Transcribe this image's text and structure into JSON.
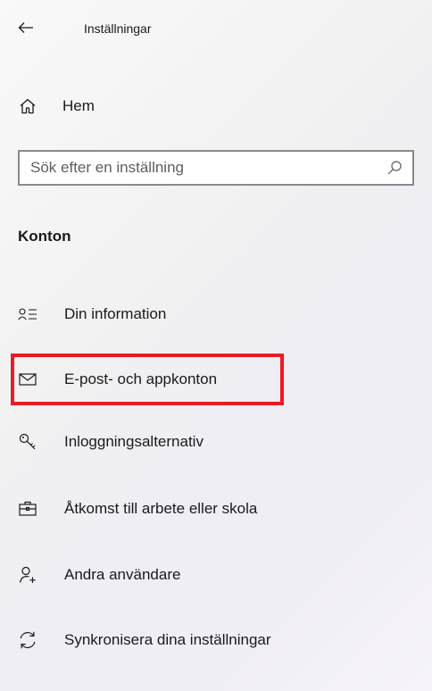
{
  "header": {
    "back_icon": "arrow-left-icon",
    "title": "Inställningar"
  },
  "home": {
    "icon": "home-icon",
    "label": "Hem"
  },
  "search": {
    "placeholder": "Sök efter en inställning",
    "value": "",
    "icon": "search-icon"
  },
  "section": {
    "heading": "Konton"
  },
  "nav": {
    "items": [
      {
        "icon": "person-list-icon",
        "label": "Din information"
      },
      {
        "icon": "mail-icon",
        "label": "E-post- och appkonton",
        "highlighted": true
      },
      {
        "icon": "key-icon",
        "label": "Inloggningsalternativ"
      },
      {
        "icon": "briefcase-icon",
        "label": "Åtkomst till arbete eller skola"
      },
      {
        "icon": "add-person-icon",
        "label": "Andra användare"
      },
      {
        "icon": "sync-icon",
        "label": "Synkronisera dina inställningar"
      }
    ]
  },
  "colors": {
    "highlight": "#e81c24",
    "text": "#1a1a1a",
    "search_border": "#8a8a8a"
  }
}
